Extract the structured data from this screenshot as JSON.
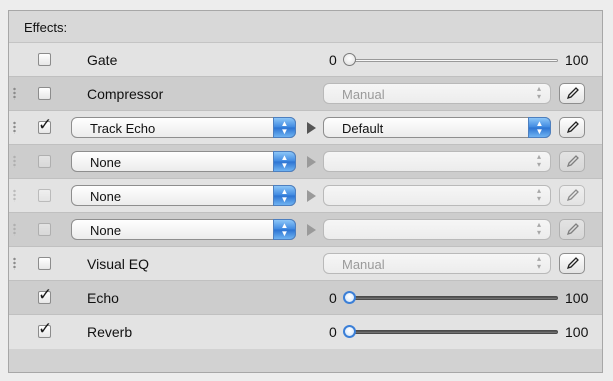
{
  "header": {
    "title": "Effects:"
  },
  "rows": [
    {
      "kind": "slider",
      "label": "Gate",
      "checked": false,
      "min": "0",
      "max": "100",
      "value": 0,
      "active": false
    },
    {
      "kind": "preset",
      "label": "Compressor",
      "checked": false,
      "preset": "Manual",
      "preset_enabled": false
    },
    {
      "kind": "chain",
      "effect": "Track Echo",
      "checked": true,
      "preset": "Default",
      "preset_enabled": true
    },
    {
      "kind": "chain",
      "effect": "None",
      "checked": false,
      "preset": "",
      "preset_enabled": false
    },
    {
      "kind": "chain",
      "effect": "None",
      "checked": false,
      "preset": "",
      "preset_enabled": false
    },
    {
      "kind": "chain",
      "effect": "None",
      "checked": false,
      "preset": "",
      "preset_enabled": false
    },
    {
      "kind": "preset",
      "label": "Visual EQ",
      "checked": false,
      "preset": "Manual",
      "preset_enabled": false
    },
    {
      "kind": "slider",
      "label": "Echo",
      "checked": true,
      "min": "0",
      "max": "100",
      "value": 0,
      "active": true
    },
    {
      "kind": "slider",
      "label": "Reverb",
      "checked": true,
      "min": "0",
      "max": "100",
      "value": 0,
      "active": true
    }
  ],
  "icons": {
    "checkbox_mark": "checkmark-icon",
    "edit": "pencil-icon",
    "arrow": "play-triangle-icon",
    "popup": "up-down-arrows-icon"
  },
  "colors": {
    "accent": "#3d87e0"
  }
}
